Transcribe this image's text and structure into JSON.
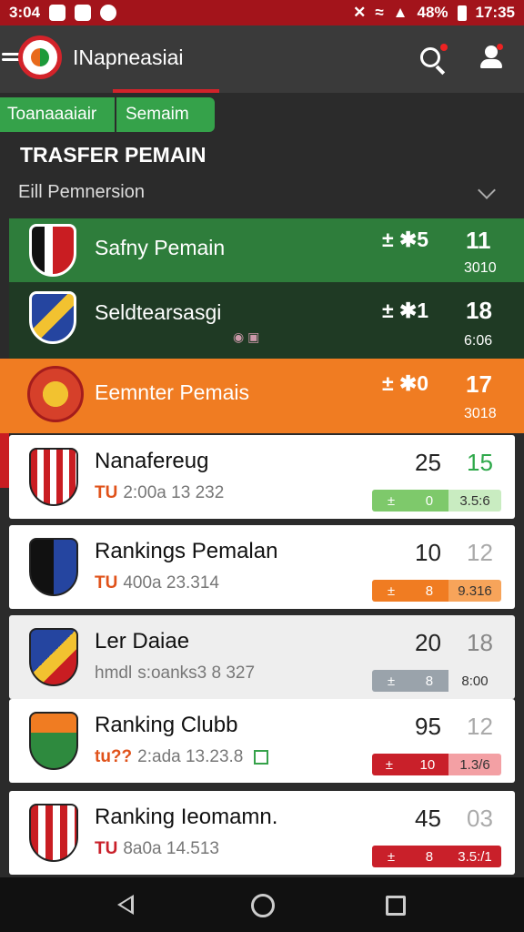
{
  "status_bar": {
    "time_left": "3:04",
    "battery": "48%",
    "time_right": "17:35"
  },
  "app": {
    "title": "INapneasiai"
  },
  "tabs": [
    {
      "label": "Toanaaaiair"
    },
    {
      "label": "Semaim"
    }
  ],
  "section_title": "TRASFER PEMAIN",
  "filter_label": "Eill Pemnersion",
  "highlight_rows": [
    {
      "name": "Safny Pemain",
      "transfer": "± ✱5",
      "rank": "11",
      "sub": "3010",
      "bg": "#2e7d3b"
    },
    {
      "name": "Seldtearsasgi",
      "transfer": "± ✱1",
      "rank": "18",
      "sub": "6:06",
      "bg": "#1f3a24"
    },
    {
      "name": "Eemnter Pemais",
      "transfer": "± ✱0",
      "rank": "17",
      "sub": "3018",
      "bg": "#f07c22"
    }
  ],
  "cards": [
    {
      "name": "Nanafereug",
      "tag": "TU",
      "meta": "2:00a 13 232",
      "v1": "25",
      "v2": "15",
      "v2_color": "#2ea84a",
      "pill_left_color": "#7ec96b",
      "pill_right_color": "#c9ecc1",
      "pill_sign": "±",
      "pill_val": "0",
      "pill_right": "3.5:6"
    },
    {
      "name": "Rankings Pemalan",
      "tag": "TU",
      "meta": "400a 23.314",
      "v1": "10",
      "v2": "12",
      "v2_color": "#aaaaaa",
      "pill_left_color": "#f07c22",
      "pill_right_color": "#f7a45a",
      "pill_sign": "±",
      "pill_val": "8",
      "pill_right": "9.316"
    },
    {
      "name": "Ler Daiae",
      "tag": "hmdl",
      "meta": "s:oanks3 8 327",
      "v1": "20",
      "v2": "18",
      "v2_color": "#888888",
      "pill_left_color": "#9aa3ab",
      "pill_right_color": "#eeeeee",
      "pill_sign": "±",
      "pill_val": "8",
      "pill_right": "8:00"
    },
    {
      "name": "Ranking Clubb",
      "tag": "tu??",
      "meta": "2:ada 13.23.8",
      "v1": "95",
      "v2": "12",
      "v2_color": "#aaaaaa",
      "pill_left_color": "#c9202a",
      "pill_right_color": "#f3a0a4",
      "pill_sign": "±",
      "pill_val": "10",
      "pill_right": "1.3/6"
    },
    {
      "name": "Ranking Ieomamn.",
      "tag": "TU",
      "meta": "8a0a 14.513",
      "v1": "45",
      "v2": "03",
      "v2_color": "#aaaaaa",
      "pill_left_color": "#c9202a",
      "pill_right_color": "#c9202a",
      "pill_sign": "±",
      "pill_val": "8",
      "pill_right": "3.5:/1"
    }
  ]
}
